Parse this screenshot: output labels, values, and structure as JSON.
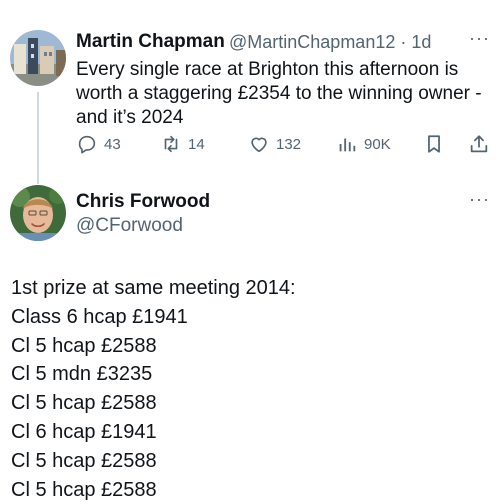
{
  "tweet1": {
    "author_name": "Martin Chapman",
    "handle_time": "@MartinChapman12 · 1d",
    "more_label": "···",
    "text_lines": [
      "Every single race at Brighton this afternoon is",
      "worth a staggering £2354 to the winning owner -",
      "and it’s 2024"
    ],
    "actions": {
      "replies": "43",
      "reposts": "14",
      "likes": "132",
      "views": "90K"
    }
  },
  "tweet2": {
    "author_name": "Chris Forwood",
    "handle": "@CForwood",
    "more_label": "···",
    "text_lines": [
      "1st prize at same meeting 2014:",
      "Class 6 hcap £1941",
      "Cl 5 hcap £2588",
      "Cl 5 mdn £3235",
      "Cl 5 hcap £2588",
      "Cl 6 hcap £1941",
      "Cl 5 hcap £2588",
      "Cl 5 hcap £2588"
    ]
  },
  "icons": {
    "reply": "reply-icon",
    "repost": "repost-icon",
    "like": "like-icon",
    "views": "views-icon",
    "bookmark": "bookmark-icon",
    "share": "share-icon"
  },
  "colors": {
    "text": "#0f1419",
    "muted": "#536471",
    "thread_line": "#cfd9de"
  }
}
